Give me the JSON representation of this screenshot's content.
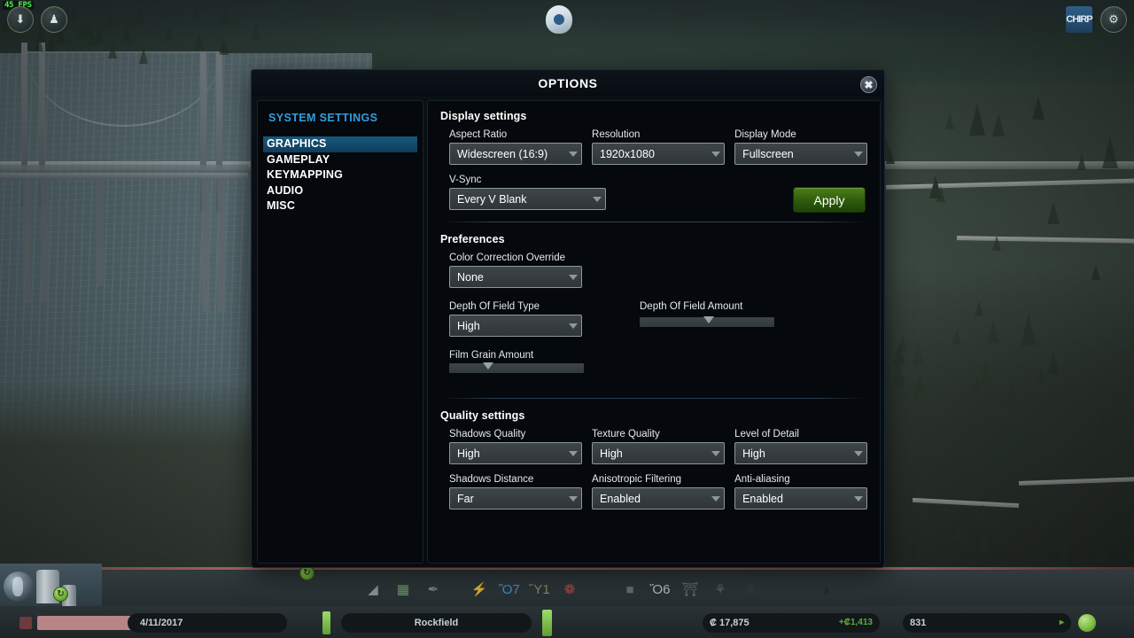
{
  "game_hud": {
    "fps": "45 FPS",
    "top_left_buttons": [
      {
        "name": "unlock-icon",
        "glyph": "⬇"
      },
      {
        "name": "info-views-icon",
        "glyph": "♟"
      }
    ],
    "top_right": {
      "chirper_label": "CHIRP",
      "gear_glyph": "⚙"
    },
    "toolbar_icons": [
      {
        "name": "bulldoze-icon",
        "glyph": "◢",
        "color": "#9aa7ad"
      },
      {
        "name": "zoning-icon",
        "glyph": "▦",
        "color": "#7fb07a"
      },
      {
        "name": "district-icon",
        "glyph": "✒",
        "color": "#8b949a"
      },
      {
        "name": "electricity-icon",
        "glyph": "⚡",
        "color": "#3e6fd4"
      },
      {
        "name": "water-icon",
        "glyph": "Ὂ7",
        "color": "#4f9fd8"
      },
      {
        "name": "garbage-icon",
        "glyph": "Ὕ1",
        "color": "#9a9a6a"
      },
      {
        "name": "healthcare-icon",
        "glyph": "❁",
        "color": "#c94f4f"
      },
      {
        "name": "fire-icon",
        "glyph": "△",
        "color": "#2c3336"
      },
      {
        "name": "police-icon",
        "glyph": "■",
        "color": "#6d757a"
      },
      {
        "name": "education-icon",
        "glyph": "Ὅ6",
        "color": "#d4d8db"
      },
      {
        "name": "transport-icon",
        "glyph": "⛩",
        "color": "#767e84"
      },
      {
        "name": "parks-icon",
        "glyph": "⚘",
        "color": "#5f6a6f"
      },
      {
        "name": "unique-buildings-icon",
        "glyph": "♜",
        "color": "#33393c"
      },
      {
        "name": "monuments-icon",
        "glyph": "△",
        "color": "#2e3437"
      },
      {
        "name": "roads-icon",
        "glyph": "▲",
        "color": "#23282b"
      }
    ],
    "status_bar": {
      "date": "4/11/2017",
      "city_name": "Rockfield",
      "money": "₡ 17,875",
      "money_delta": "+₡1,413",
      "population": "831"
    }
  },
  "dialog": {
    "title": "OPTIONS",
    "close_glyph": "✖",
    "sidebar": {
      "heading": "SYSTEM SETTINGS",
      "items": [
        {
          "label": "GRAPHICS",
          "active": true
        },
        {
          "label": "GAMEPLAY",
          "active": false
        },
        {
          "label": "KEYMAPPING",
          "active": false
        },
        {
          "label": "AUDIO",
          "active": false
        },
        {
          "label": "MISC",
          "active": false
        }
      ]
    },
    "sections": {
      "display": {
        "title": "Display settings",
        "aspect_ratio": {
          "label": "Aspect Ratio",
          "value": "Widescreen (16:9)"
        },
        "resolution": {
          "label": "Resolution",
          "value": "1920x1080"
        },
        "display_mode": {
          "label": "Display Mode",
          "value": "Fullscreen"
        },
        "vsync": {
          "label": "V-Sync",
          "value": "Every V Blank"
        },
        "apply_label": "Apply"
      },
      "preferences": {
        "title": "Preferences",
        "color_correction": {
          "label": "Color Correction Override",
          "value": "None"
        },
        "dof_type": {
          "label": "Depth Of Field Type",
          "value": "High"
        },
        "dof_amount": {
          "label": "Depth Of Field Amount",
          "percent": 51
        },
        "film_grain": {
          "label": "Film Grain Amount",
          "percent": 29
        }
      },
      "quality": {
        "title": "Quality settings",
        "shadows_quality": {
          "label": "Shadows Quality",
          "value": "High"
        },
        "texture_quality": {
          "label": "Texture Quality",
          "value": "High"
        },
        "level_of_detail": {
          "label": "Level of Detail",
          "value": "High"
        },
        "shadows_distance": {
          "label": "Shadows Distance",
          "value": "Far"
        },
        "anisotropic_filtering": {
          "label": "Anisotropic Filtering",
          "value": "Enabled"
        },
        "anti_aliasing": {
          "label": "Anti-aliasing",
          "value": "Enabled"
        }
      }
    }
  },
  "colors": {
    "accent_blue": "#2f9fe0",
    "selection_blue": "#17597f",
    "apply_green": "#4f7f18",
    "fps_green": "#4cf04c",
    "dialog_bg": "#05080c"
  }
}
